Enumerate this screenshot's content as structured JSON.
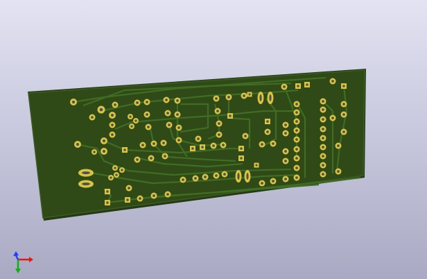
{
  "viewer": {
    "background_top": "#e3e3f2",
    "background_bottom": "#a9a9c3"
  },
  "board": {
    "soldermask_color": "#2f4a17",
    "edge_color": "#3c5c22",
    "track_color": "#3f6d24",
    "pad_color": "#d8c440",
    "pad_highlight": "#f5e46a",
    "hole_color": "#505050"
  },
  "axes_gizmo": {
    "x_axis_color": "#e01818",
    "y_axis_color": "#10b010",
    "z_axis_color": "#2040ff",
    "icon": "xyz-axes-icon"
  }
}
